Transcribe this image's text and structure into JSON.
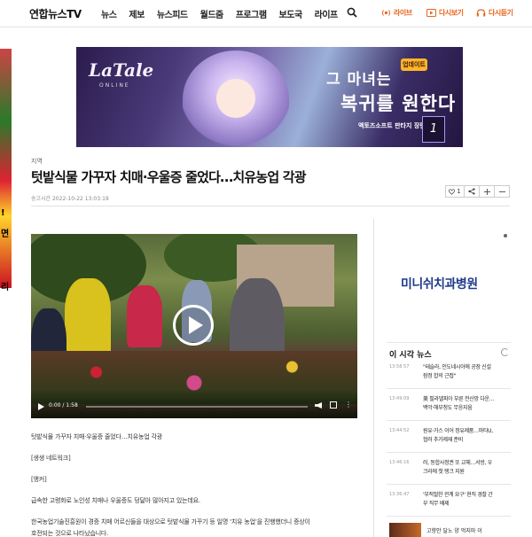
{
  "header": {
    "logo": "연합뉴스TV",
    "nav": [
      "뉴스",
      "제보",
      "뉴스피드",
      "월드줌",
      "프로그램",
      "보도국",
      "라이프"
    ],
    "live": "라이브",
    "replay": "다시보기",
    "relisten": "다시듣기",
    "accent_color": "#e8641b"
  },
  "left_ad": {
    "lines": [
      "!",
      "면",
      "리"
    ]
  },
  "banner": {
    "logo": "LaTale",
    "logo_sub": "ONLINE",
    "title_line1": "그 마녀는",
    "title_line2": "복귀를 원한다",
    "caption": "액토즈소프트 판타지 장편 RPG",
    "badge": "업데이트",
    "card_number": "1"
  },
  "article": {
    "section": "지역",
    "headline": "텃밭식물 가꾸자 치매·우울증 줄었다…치유농업 각광",
    "sent_time": "송고시간 2022-10-22 13:03:19",
    "like_count": "1",
    "video": {
      "time": "0:00 / 1:58"
    },
    "paragraphs": [
      "텃밭식물 가꾸자 치매·우울증 줄었다…치유농업 각광",
      "[생생 네트워크]",
      "[앵커]",
      "급속한 고령화로 노인성 치매나 우울증도 덩달아 많아지고 있는데요.",
      "한국농업기술진흥원이 경증 치매 어르신들을 대상으로 텃밭식물 가꾸기 등 일명 '치유 농업'을 진행했더니 증상이",
      "호전되는 것으로 나타났습니다."
    ]
  },
  "sidebar": {
    "ad_text": "미니쉬치과병원",
    "title": "이 시각 뉴스",
    "news": [
      {
        "time": "13:58:57",
        "lines": [
          "\"테슬라, 인도네시아에 공장 신설",
          "잠정 합의 근접\""
        ]
      },
      {
        "time": "13:49:09",
        "lines": [
          "美 필라델피아 부른 전산망 다운…",
          "백악·해부청도 무응지움"
        ]
      },
      {
        "time": "13:44:52",
        "lines": [
          "원유·가스 이어 정유제품…마타U,",
          "협러 추가제재 준비"
        ]
      },
      {
        "time": "13:46:16",
        "lines": [
          "러, 동합사정권 또 교체…서방, 우",
          "크라에 첫 탱크 지원"
        ]
      },
      {
        "time": "13:36:47",
        "lines": [
          "'부적절한 관계 요구' 현직 경찰 간",
          "부 직무 배제"
        ]
      }
    ],
    "bottom_item": "고향안 달노 양 먹지마 이"
  }
}
